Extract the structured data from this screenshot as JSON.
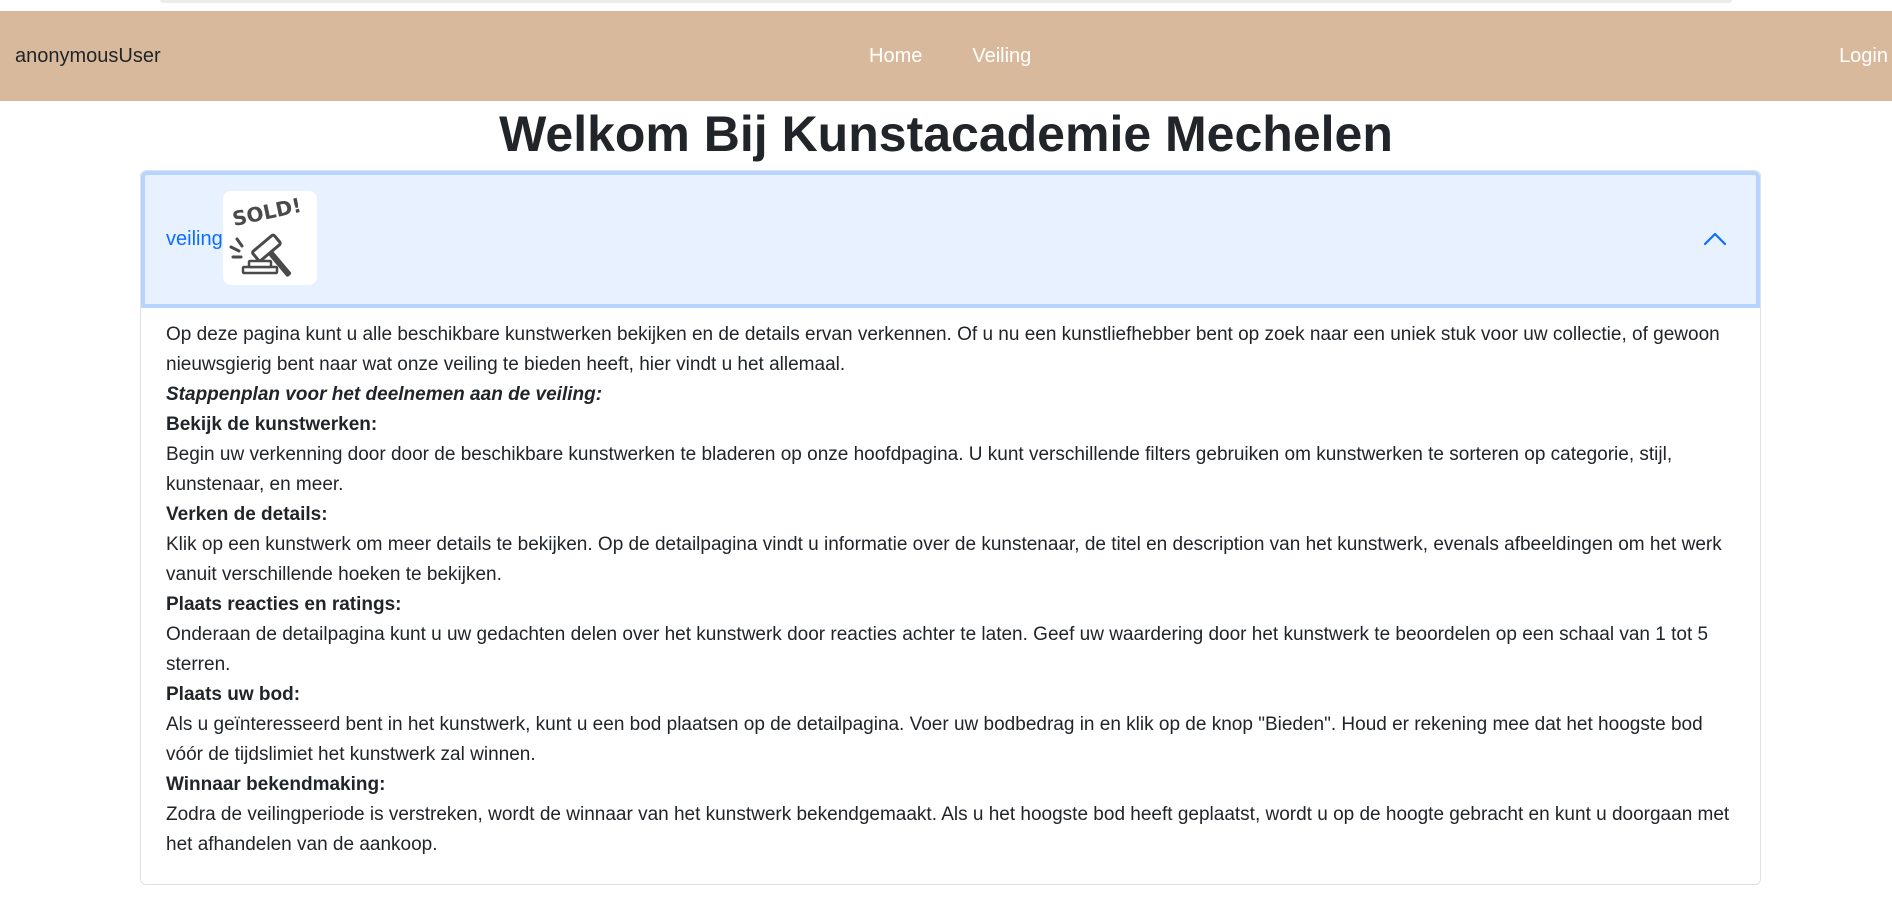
{
  "navbar": {
    "user": "anonymousUser",
    "links": [
      "Home",
      "Veiling"
    ],
    "login": "Login",
    "background_color": "#d9b99b"
  },
  "page_title": "Welkom Bij Kunstacademie Mechelen",
  "accordion": {
    "label": "veiling",
    "image_text": "SOLD!",
    "image_icon": "gavel-icon",
    "chevron_icon": "chevron-up-icon",
    "intro": "Op deze pagina kunt u alle beschikbare kunstwerken bekijken en de details ervan verkennen. Of u nu een kunstliefhebber bent op zoek naar een uniek stuk voor uw collectie, of gewoon nieuwsgierig bent naar wat onze veiling te bieden heeft, hier vindt u het allemaal.",
    "steps_heading": "Stappenplan voor het deelnemen aan de veiling:",
    "steps": [
      {
        "title": "Bekijk de kunstwerken:",
        "text": "Begin uw verkenning door door de beschikbare kunstwerken te bladeren op onze hoofdpagina. U kunt verschillende filters gebruiken om kunstwerken te sorteren op categorie, stijl, kunstenaar, en meer."
      },
      {
        "title": "Verken de details:",
        "text": "Klik op een kunstwerk om meer details te bekijken. Op de detailpagina vindt u informatie over de kunstenaar, de titel en description van het kunstwerk, evenals afbeeldingen om het werk vanuit verschillende hoeken te bekijken."
      },
      {
        "title": "Plaats reacties en ratings:",
        "text": "Onderaan de detailpagina kunt u uw gedachten delen over het kunstwerk door reacties achter te laten. Geef uw waardering door het kunstwerk te beoordelen op een schaal van 1 tot 5 sterren."
      },
      {
        "title": "Plaats uw bod:",
        "text": "Als u geïnteresseerd bent in het kunstwerk, kunt u een bod plaatsen op de detailpagina. Voer uw bodbedrag in en klik op de knop \"Bieden\". Houd er rekening mee dat het hoogste bod vóór de tijdslimiet het kunstwerk zal winnen."
      },
      {
        "title": "Winnaar bekendmaking:",
        "text": "Zodra de veilingperiode is verstreken, wordt de winnaar van het kunstwerk bekendgemaakt. Als u het hoogste bod heeft geplaatst, wordt u op de hoogte gebracht en kunt u doorgaan met het afhandelen van de aankoop."
      }
    ]
  }
}
